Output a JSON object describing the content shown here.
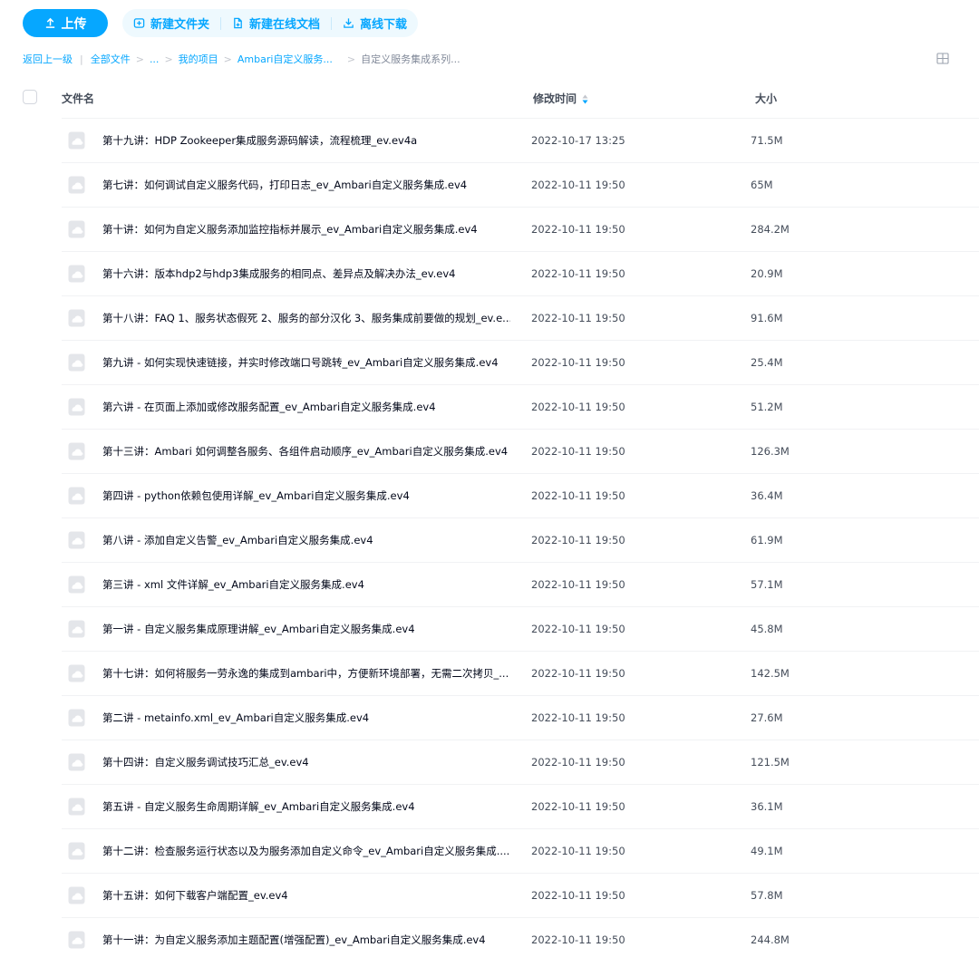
{
  "toolbar": {
    "upload_label": "上传",
    "new_folder_label": "新建文件夹",
    "new_doc_label": "新建在线文档",
    "offline_download_label": "离线下载",
    "accent_color": "#06a7ff",
    "icons": {
      "upload": "upload-icon",
      "new_folder": "folder-plus-icon",
      "new_doc": "doc-plus-icon",
      "offline_download": "download-icon"
    }
  },
  "breadcrumb": {
    "back": "返回上一级",
    "items": [
      "全部文件",
      "...",
      "我的项目",
      "Ambari自定义服务..."
    ],
    "current": "自定义服务集成系列..."
  },
  "view_toggle_icon": "grid-view-icon",
  "columns": {
    "name": "文件名",
    "modified": "修改时间",
    "size": "大小"
  },
  "files": [
    {
      "name": "第十九讲：HDP Zookeeper集成服务源码解读，流程梳理_ev.ev4a",
      "modified": "2022-10-17 13:25",
      "size": "71.5M"
    },
    {
      "name": "第七讲：如何调试自定义服务代码，打印日志_ev_Ambari自定义服务集成.ev4",
      "modified": "2022-10-11 19:50",
      "size": "65M"
    },
    {
      "name": "第十讲：如何为自定义服务添加监控指标并展示_ev_Ambari自定义服务集成.ev4",
      "modified": "2022-10-11 19:50",
      "size": "284.2M"
    },
    {
      "name": "第十六讲：版本hdp2与hdp3集成服务的相同点、差异点及解决办法_ev.ev4",
      "modified": "2022-10-11 19:50",
      "size": "20.9M"
    },
    {
      "name": "第十八讲：FAQ 1、服务状态假死 2、服务的部分汉化 3、服务集成前要做的规划_ev.e...",
      "modified": "2022-10-11 19:50",
      "size": "91.6M"
    },
    {
      "name": "第九讲 - 如何实现快速链接，并实时修改端口号跳转_ev_Ambari自定义服务集成.ev4",
      "modified": "2022-10-11 19:50",
      "size": "25.4M"
    },
    {
      "name": "第六讲 - 在页面上添加或修改服务配置_ev_Ambari自定义服务集成.ev4",
      "modified": "2022-10-11 19:50",
      "size": "51.2M"
    },
    {
      "name": "第十三讲：Ambari 如何调整各服务、各组件启动顺序_ev_Ambari自定义服务集成.ev4",
      "modified": "2022-10-11 19:50",
      "size": "126.3M"
    },
    {
      "name": "第四讲 - python依赖包使用详解_ev_Ambari自定义服务集成.ev4",
      "modified": "2022-10-11 19:50",
      "size": "36.4M"
    },
    {
      "name": "第八讲 - 添加自定义告警_ev_Ambari自定义服务集成.ev4",
      "modified": "2022-10-11 19:50",
      "size": "61.9M"
    },
    {
      "name": "第三讲 - xml 文件详解_ev_Ambari自定义服务集成.ev4",
      "modified": "2022-10-11 19:50",
      "size": "57.1M"
    },
    {
      "name": "第一讲 - 自定义服务集成原理讲解_ev_Ambari自定义服务集成.ev4",
      "modified": "2022-10-11 19:50",
      "size": "45.8M"
    },
    {
      "name": "第十七讲：如何将服务一劳永逸的集成到ambari中，方便新环境部署，无需二次拷贝_...",
      "modified": "2022-10-11 19:50",
      "size": "142.5M"
    },
    {
      "name": "第二讲 - metainfo.xml_ev_Ambari自定义服务集成.ev4",
      "modified": "2022-10-11 19:50",
      "size": "27.6M"
    },
    {
      "name": "第十四讲：自定义服务调试技巧汇总_ev.ev4",
      "modified": "2022-10-11 19:50",
      "size": "121.5M"
    },
    {
      "name": "第五讲 - 自定义服务生命周期详解_ev_Ambari自定义服务集成.ev4",
      "modified": "2022-10-11 19:50",
      "size": "36.1M"
    },
    {
      "name": "第十二讲：检查服务运行状态以及为服务添加自定义命令_ev_Ambari自定义服务集成....",
      "modified": "2022-10-11 19:50",
      "size": "49.1M"
    },
    {
      "name": "第十五讲：如何下载客户端配置_ev.ev4",
      "modified": "2022-10-11 19:50",
      "size": "57.8M"
    },
    {
      "name": "第十一讲：为自定义服务添加主题配置(增强配置)_ev_Ambari自定义服务集成.ev4",
      "modified": "2022-10-11 19:50",
      "size": "244.8M"
    }
  ]
}
